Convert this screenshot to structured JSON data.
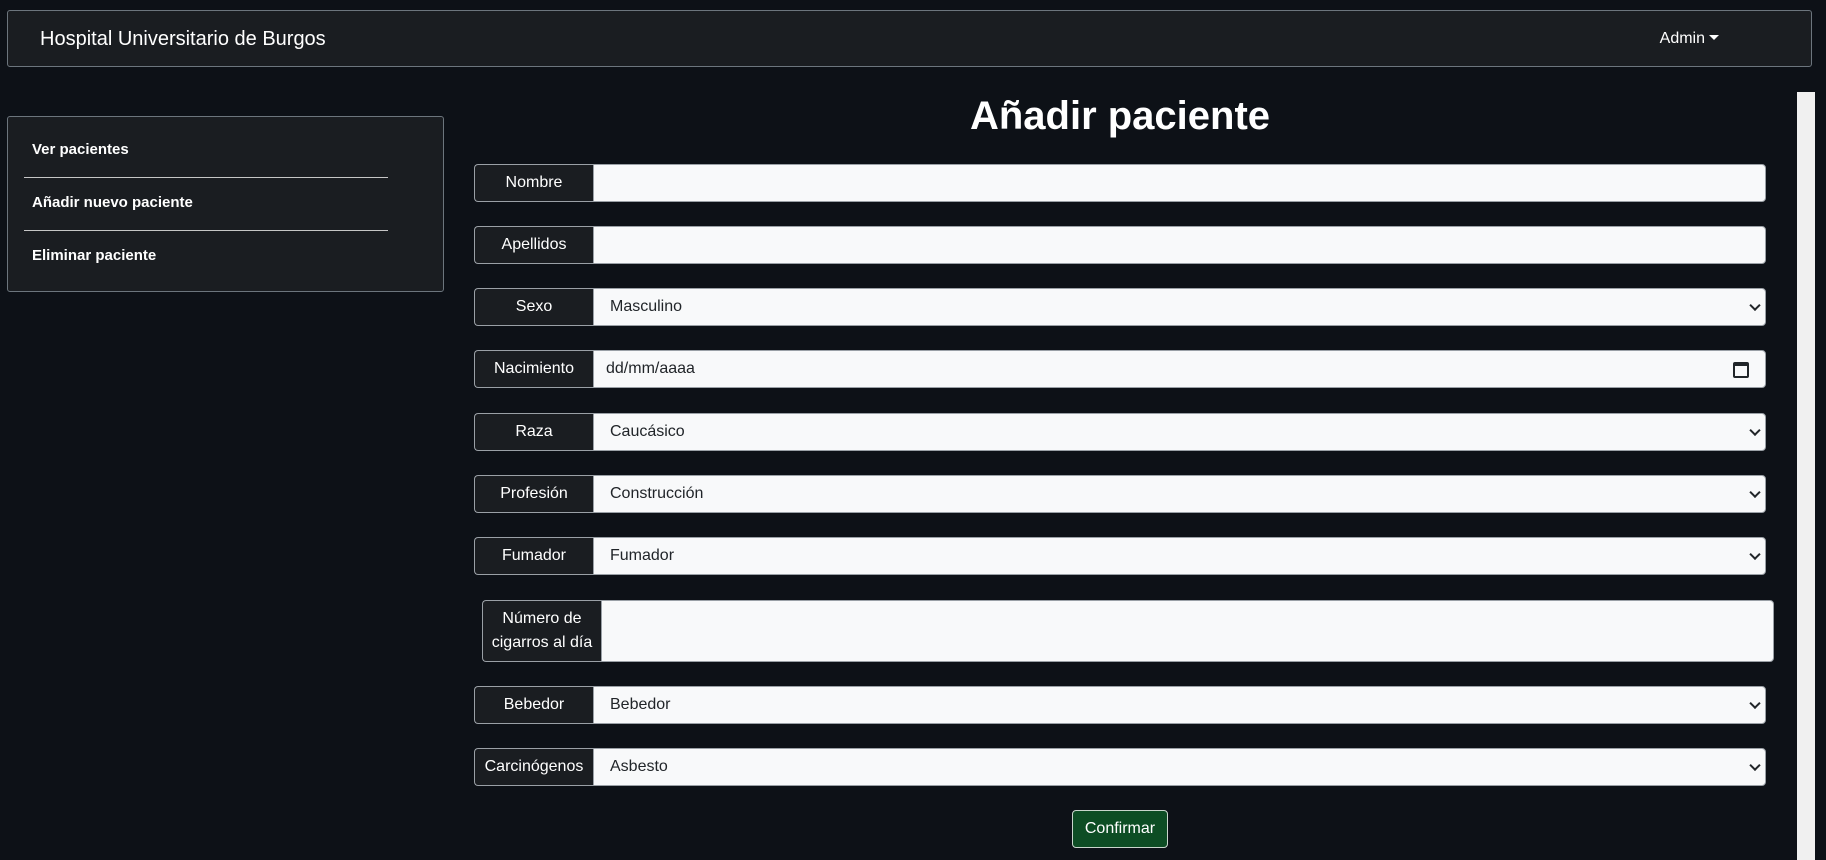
{
  "navbar": {
    "brand": "Hospital Universitario de Burgos",
    "admin_label": "Admin"
  },
  "sidebar": {
    "items": [
      {
        "label": "Ver pacientes"
      },
      {
        "label": "Añadir nuevo paciente"
      },
      {
        "label": "Eliminar paciente"
      }
    ]
  },
  "form": {
    "title": "Añadir paciente",
    "fields": {
      "nombre": {
        "label": "Nombre",
        "value": ""
      },
      "apellidos": {
        "label": "Apellidos",
        "value": ""
      },
      "sexo": {
        "label": "Sexo",
        "value": "Masculino"
      },
      "nacimiento": {
        "label": "Nacimiento",
        "value": "dd/mm/aaaa"
      },
      "raza": {
        "label": "Raza",
        "value": "Caucásico"
      },
      "profesion": {
        "label": "Profesión",
        "value": "Construcción"
      },
      "fumador": {
        "label": "Fumador",
        "value": "Fumador"
      },
      "cigarros": {
        "label_line1": "Número de",
        "label_line2": "cigarros al día",
        "value": ""
      },
      "bebedor": {
        "label": "Bebedor",
        "value": "Bebedor"
      },
      "carcinogenos": {
        "label": "Carcinógenos",
        "value": "Asbesto"
      }
    },
    "confirm_label": "Confirmar"
  },
  "colors": {
    "background": "#0d1117",
    "panel": "#1a1d21",
    "input": "#f8f9fa",
    "confirm": "#0d4d24"
  }
}
